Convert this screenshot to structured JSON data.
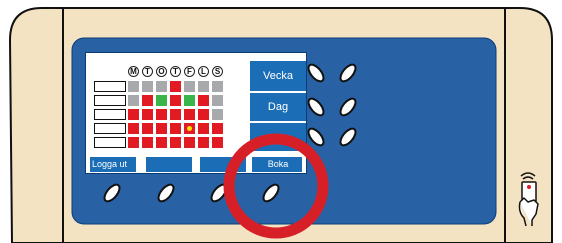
{
  "days": [
    "M",
    "T",
    "O",
    "T",
    "F",
    "L",
    "S"
  ],
  "side_buttons": {
    "week": "Vecka",
    "day": "Dag"
  },
  "bottom_bar": {
    "logout": "Logga ut",
    "book": "Boka"
  },
  "colors": {
    "panel": "#f3e3c3",
    "bezel": "#2962a4",
    "booked": "#e21b23",
    "free": "#39b54a",
    "unavailable": "#a7a9ac",
    "highlight": "#d71f27"
  },
  "icons": [
    "key-icon",
    "card-reader-icon",
    "highlight-circle"
  ]
}
